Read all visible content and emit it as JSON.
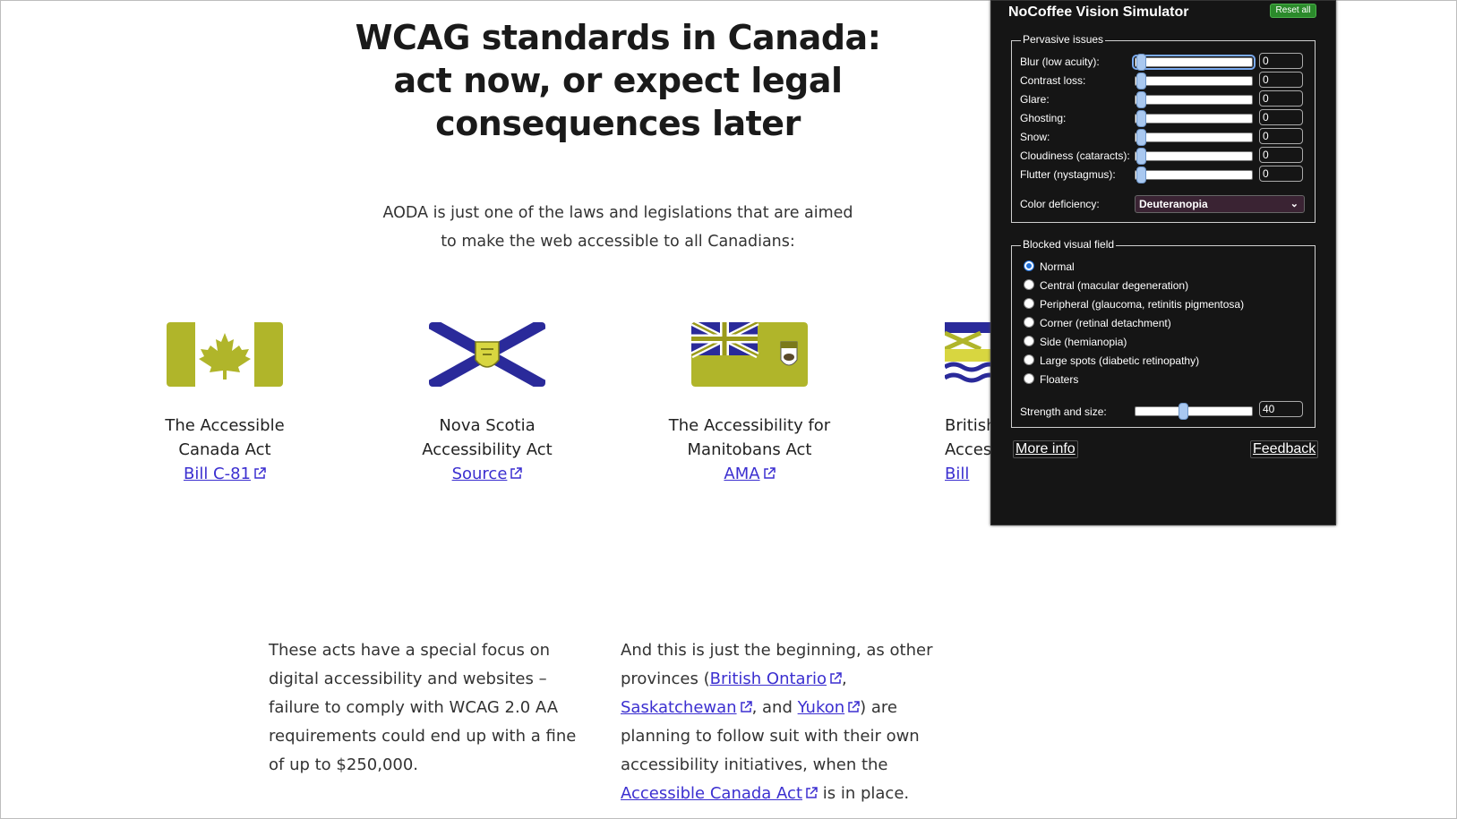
{
  "page": {
    "title_lines": [
      "WCAG standards in Canada:",
      "act now, or expect legal",
      "consequences later"
    ],
    "intro_lines": [
      "AODA is just one of the laws and legislations that are aimed",
      "to make the web accessible to all Canadians:"
    ],
    "cards": [
      {
        "title_lines": [
          "The Accessible",
          "Canada Act"
        ],
        "link": "Bill C-81"
      },
      {
        "title_lines": [
          "Nova Scotia",
          "Accessibility Act"
        ],
        "link": "Source"
      },
      {
        "title_lines": [
          "The Accessibility for",
          "Manitobans Act"
        ],
        "link": "AMA"
      },
      {
        "title_lines": [
          "British",
          "Acces"
        ],
        "link": "Bill"
      }
    ],
    "para_left_lines": [
      "These acts have a special focus on",
      "digital accessibility and websites –",
      "failure to comply with WCAG 2.0 AA",
      "requirements could end up with a fine",
      "of up to $250,000."
    ],
    "para_right": {
      "line1": "And this is just the beginning, as other",
      "line2_pre": "provinces (",
      "link_ontario": "British Ontario",
      "line2_post": ",",
      "link_sask": "Saskatchewan",
      "line3_mid": ", and ",
      "link_yukon": "Yukon",
      "line3_post": ") are",
      "line4": "planning to follow suit with their own",
      "line5": "accessibility initiatives, when the",
      "link_aca": "Accessible Canada Act",
      "line6_post": " is in place."
    }
  },
  "panel": {
    "title": "NoCoffee Vision Simulator",
    "reset_label": "Reset all",
    "pervasive_legend": "Pervasive issues",
    "pervasive": [
      {
        "label": "Blur (low acuity):",
        "value": "0"
      },
      {
        "label": "Contrast loss:",
        "value": "0"
      },
      {
        "label": "Glare:",
        "value": "0"
      },
      {
        "label": "Ghosting:",
        "value": "0"
      },
      {
        "label": "Snow:",
        "value": "0"
      },
      {
        "label": "Cloudiness (cataracts):",
        "value": "0"
      },
      {
        "label": "Flutter (nystagmus):",
        "value": "0"
      }
    ],
    "color_label": "Color deficiency:",
    "color_value": "Deuteranopia",
    "blocked_legend": "Blocked visual field",
    "blocked_options": [
      {
        "label": "Normal",
        "checked": true
      },
      {
        "label": "Central (macular degeneration)",
        "checked": false
      },
      {
        "label": "Peripheral (glaucoma, retinitis pigmentosa)",
        "checked": false
      },
      {
        "label": "Corner (retinal detachment)",
        "checked": false
      },
      {
        "label": "Side (hemianopia)",
        "checked": false
      },
      {
        "label": "Large spots (diabetic retinopathy)",
        "checked": false
      },
      {
        "label": "Floaters",
        "checked": false
      }
    ],
    "strength_label": "Strength and size:",
    "strength_value": "40",
    "strength_fraction": 0.4,
    "more_info": "More info",
    "feedback": "Feedback"
  },
  "colors": {
    "flag_olive": "#b0b52a",
    "flag_navy": "#2a2a9a",
    "link": "#3b2fd0",
    "panel_bg": "#151515",
    "reset_green": "#2b8a2b"
  },
  "icons": [
    "maple-leaf-icon",
    "external-link-icon",
    "chevron-down-icon",
    "radio-icon"
  ]
}
